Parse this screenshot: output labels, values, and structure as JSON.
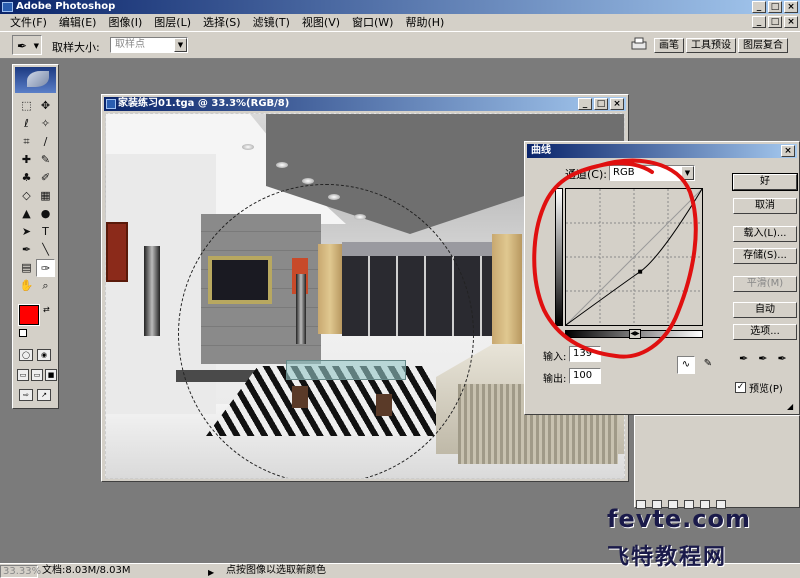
{
  "app": {
    "title": "Adobe Photoshop",
    "window_buttons": [
      "_",
      "□",
      "×"
    ]
  },
  "menu": {
    "items": [
      "文件(F)",
      "编辑(E)",
      "图像(I)",
      "图层(L)",
      "选择(S)",
      "滤镜(T)",
      "视图(V)",
      "窗口(W)",
      "帮助(H)"
    ]
  },
  "options": {
    "sample_size_label": "取样大小:",
    "sample_size_value": "取样点",
    "well_tabs": [
      "画笔",
      "工具预设",
      "图层复合"
    ]
  },
  "document": {
    "title": "家装练习01.tga @ 33.3%(RGB/8)",
    "window_buttons": [
      "_",
      "□",
      "×"
    ]
  },
  "curves": {
    "title": "曲线",
    "channel_label": "通道(C):",
    "channel_value": "RGB",
    "input_label": "输入:",
    "input_value": "139",
    "output_label": "输出:",
    "output_value": "100",
    "buttons": {
      "ok": "好",
      "cancel": "取消",
      "load": "载入(L)...",
      "save": "存储(S)...",
      "smooth": "平滑(M)",
      "auto": "自动",
      "options": "选项..."
    },
    "preview_label": "预览(P)",
    "preview_checked": true,
    "curve_points": [
      [
        0,
        0
      ],
      [
        139,
        100
      ],
      [
        255,
        255
      ]
    ]
  },
  "status": {
    "zoom": "33.33%",
    "doc_size": "文档:8.03M/8.03M",
    "message": "点按图像以选取新颜色"
  },
  "watermark": {
    "line1": "fevte.com",
    "line2": "飞特教程网"
  },
  "colors": {
    "foreground": "#ff0000",
    "background": "#ffffff",
    "annotation": "#e01010",
    "titlebar_start": "#0a246a",
    "titlebar_end": "#a6caf0"
  }
}
